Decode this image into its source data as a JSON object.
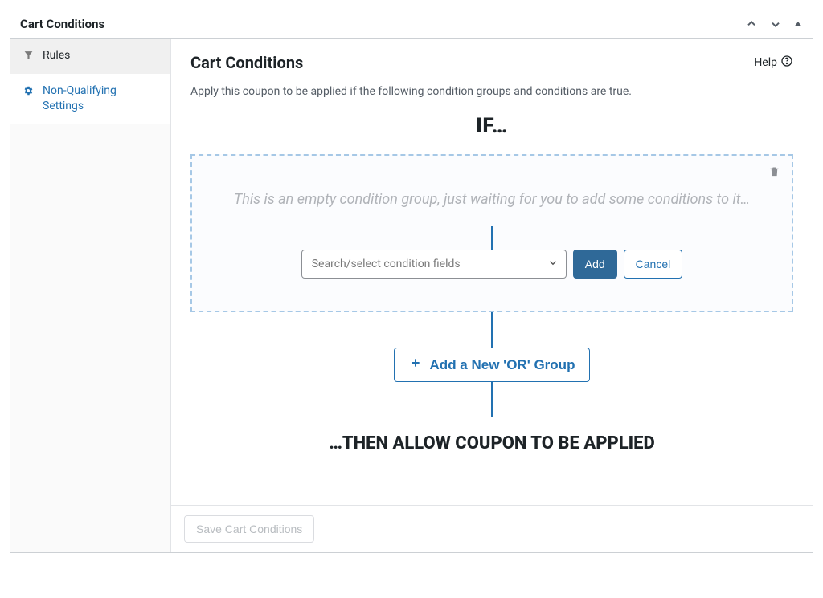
{
  "panel": {
    "title": "Cart Conditions"
  },
  "sidebar": {
    "items": [
      {
        "label": "Rules"
      },
      {
        "label": "Non-Qualifying Settings"
      }
    ]
  },
  "main": {
    "title": "Cart Conditions",
    "help_label": "Help",
    "description": "Apply this coupon to be applied if the following condition groups and conditions are true.",
    "if_label": "IF…",
    "empty_group_text": "This is an empty condition group, just waiting for you to add some conditions to it…",
    "select_placeholder": "Search/select condition fields",
    "add_label": "Add",
    "cancel_label": "Cancel",
    "or_group_label": "Add a New 'OR' Group",
    "then_label": "…THEN ALLOW COUPON TO BE APPLIED",
    "save_label": "Save Cart Conditions"
  }
}
